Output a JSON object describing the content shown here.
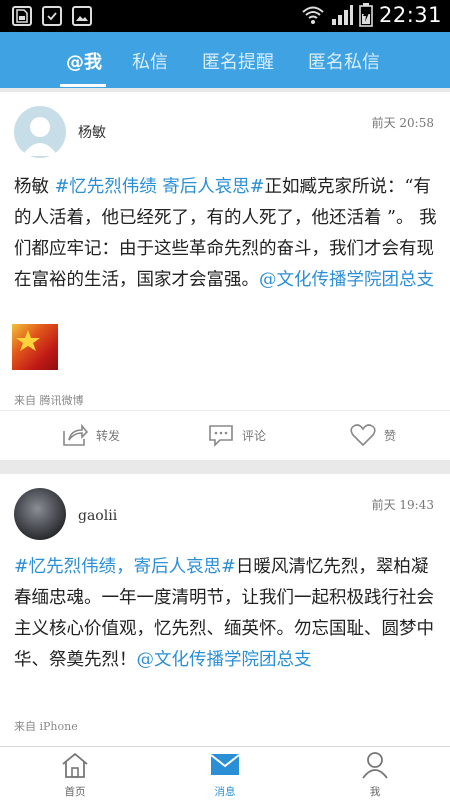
{
  "status_bar": {
    "time": "22:31"
  },
  "tabs": [
    {
      "label": "@我",
      "active": true
    },
    {
      "label": "私信",
      "active": false
    },
    {
      "label": "匿名提醒",
      "active": false
    },
    {
      "label": "匿名私信",
      "active": false
    }
  ],
  "posts": [
    {
      "username": "杨敏",
      "time": "前天 20:58",
      "text_parts": [
        {
          "text": "杨敏 ",
          "link": false
        },
        {
          "text": "#忆先烈伟绩 寄后人哀思#",
          "link": true
        },
        {
          "text": "正如臧克家所说：“有的人活着，他已经死了，有的人死了，他还活着 ”。 我们都应牢记：由于这些革命先烈的奋斗，我们才会有现在富裕的生活，国家才会富强。",
          "link": false
        },
        {
          "text": "@文化传播学院团总支",
          "link": true
        }
      ],
      "source": "来自 腾讯微博",
      "actions": {
        "repost": "转发",
        "comment": "评论",
        "like": "赞"
      }
    },
    {
      "username": "gaolii",
      "time": "前天 19:43",
      "text_parts": [
        {
          "text": "#忆先烈伟绩，寄后人哀思#",
          "link": true
        },
        {
          "text": "日暖风清忆先烈，翠柏凝春缅忠魂。一年一度清明节，让我们一起积极践行社会主义核心价值观，忆先烈、缅英怀。勿忘国耻、圆梦中华、祭奠先烈！",
          "link": false
        },
        {
          "text": "@文化传播学院团总支",
          "link": true
        }
      ],
      "source": "来自 iPhone"
    }
  ],
  "bottom_nav": [
    {
      "label": "首页",
      "icon": "home-icon",
      "active": false
    },
    {
      "label": "消息",
      "icon": "mail-icon",
      "active": true
    },
    {
      "label": "我",
      "icon": "person-icon",
      "active": false
    }
  ],
  "colors": {
    "header": "#3ea2e3",
    "link": "#2b8fd6",
    "status_bar": "#000000"
  }
}
